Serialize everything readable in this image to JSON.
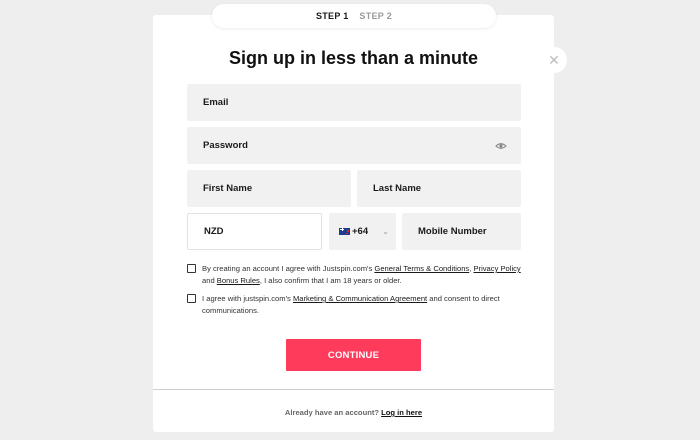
{
  "steps": {
    "step1": "STEP 1",
    "step2": "STEP 2"
  },
  "close": {
    "symbol": "✕",
    "icon": "close-icon"
  },
  "title": "Sign up in less than a minute",
  "form": {
    "email_label": "Email",
    "password_label": "Password",
    "first_name_label": "First Name",
    "last_name_label": "Last Name",
    "currency_value": "NZD",
    "country_code": "+64",
    "mobile_label": "Mobile Number"
  },
  "consent1": {
    "prefix": "By creating an account I agree with Justspin.com's ",
    "link1": "General Terms & Conditions",
    "sep": ", ",
    "link2": "Privacy Policy",
    "mid": " and ",
    "link3": "Bonus Rules",
    "suffix": ", I also confirm that I am 18 years or older."
  },
  "consent2": {
    "prefix": "I agree with justspin.com's ",
    "link": "Marketing & Communication Agreement",
    "suffix": " and consent to direct communications."
  },
  "continue_label": "CONTINUE",
  "footer": {
    "text": "Already have an account? ",
    "link": "Log in here"
  },
  "colors": {
    "accent": "#ff3b5c",
    "field_bg": "#f1f1f1"
  }
}
